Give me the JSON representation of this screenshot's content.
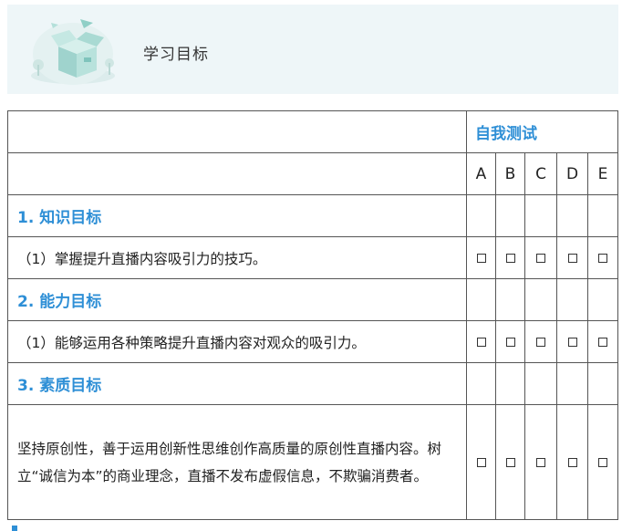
{
  "banner": {
    "title": "学习目标",
    "icon": "open-box-illustration-icon"
  },
  "table": {
    "self_test_header": "自我测试",
    "grade_letters": [
      "A",
      "B",
      "C",
      "D",
      "E"
    ],
    "sections": [
      {
        "heading": "1. 知识目标",
        "items": [
          "（1）掌握提升直播内容吸引力的技巧。"
        ]
      },
      {
        "heading": "2. 能力目标",
        "items": [
          "（1）能够运用各种策略提升直播内容对观众的吸引力。"
        ]
      },
      {
        "heading": "3. 素质目标",
        "items": [
          "坚持原创性，善于运用创新性思维创作高质量的原创性直播内容。树立“诚信为本”的商业理念，直播不发布虚假信息，不欺骗消费者。"
        ]
      }
    ]
  },
  "colors": {
    "accent": "#2e8fd6",
    "banner_bg": "#eef6f8"
  }
}
